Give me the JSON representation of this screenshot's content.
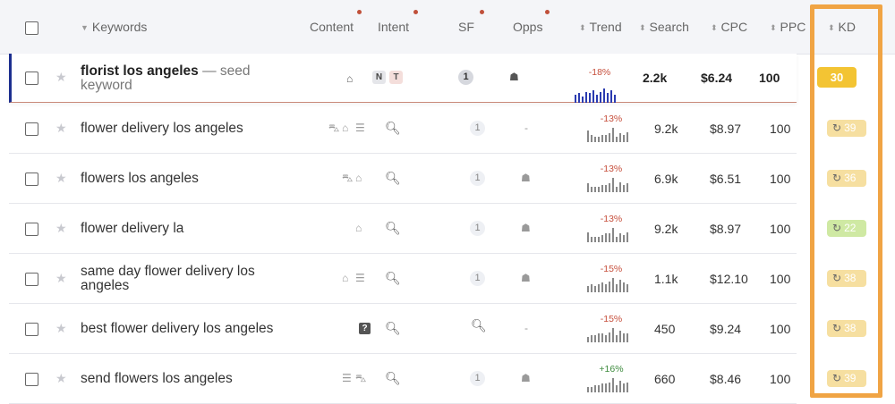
{
  "header": {
    "keywords": "Keywords",
    "content": "Content",
    "intent": "Intent",
    "sf": "SF",
    "opps": "Opps",
    "trend": "Trend",
    "search": "Search",
    "cpc": "CPC",
    "ppc": "PPC",
    "kd": "KD"
  },
  "seed": {
    "keyword": "florist los angeles",
    "suffix": "— seed",
    "suffix2": "keyword",
    "intent_n": "N",
    "intent_t": "T",
    "sf": "1",
    "trend_pct": "-18%",
    "trend": [
      5,
      6,
      4,
      7,
      6,
      8,
      5,
      7,
      9,
      6,
      8,
      5
    ],
    "search": "2.2k",
    "cpc": "$6.24",
    "ppc": "100",
    "kd": "30"
  },
  "rows": [
    {
      "keyword": "flower delivery los angeles",
      "line2": "",
      "content": "car-icon home-icon list-icon",
      "sf": "1",
      "opps": "-",
      "trend_pct": "-13%",
      "trend_dir": "neg",
      "trend": [
        8,
        5,
        4,
        4,
        5,
        5,
        6,
        10,
        4,
        6,
        5,
        7
      ],
      "search": "9.2k",
      "cpc": "$8.97",
      "ppc": "100",
      "kd": "39",
      "kd_color": "yellow"
    },
    {
      "keyword": "flowers los angeles",
      "line2": "",
      "content": "car-icon home-icon",
      "sf": "1",
      "opps": "ghost",
      "trend_pct": "-13%",
      "trend_dir": "neg",
      "trend": [
        6,
        4,
        4,
        4,
        5,
        5,
        6,
        10,
        4,
        7,
        5,
        6
      ],
      "search": "6.9k",
      "cpc": "$6.51",
      "ppc": "100",
      "kd": "36",
      "kd_color": "yellow"
    },
    {
      "keyword": "flower delivery la",
      "line2": "",
      "content": "home-icon",
      "sf": "1",
      "opps": "ghost",
      "trend_pct": "-13%",
      "trend_dir": "neg",
      "trend": [
        7,
        4,
        4,
        4,
        5,
        6,
        6,
        10,
        4,
        6,
        5,
        7
      ],
      "search": "9.2k",
      "cpc": "$8.97",
      "ppc": "100",
      "kd": "22",
      "kd_color": "green"
    },
    {
      "keyword": "same day flower delivery los",
      "line2": "angeles",
      "content": "home-icon list-icon",
      "sf": "1",
      "opps": "ghost",
      "trend_pct": "-15%",
      "trend_dir": "neg",
      "trend": [
        4,
        5,
        4,
        5,
        6,
        5,
        7,
        9,
        5,
        8,
        6,
        5
      ],
      "search": "1.1k",
      "cpc": "$12.10",
      "ppc": "100",
      "kd": "38",
      "kd_color": "yellow"
    },
    {
      "keyword": "best flower delivery los angeles",
      "line2": "",
      "content": "question-icon",
      "sf": "search",
      "opps": "-",
      "trend_pct": "-15%",
      "trend_dir": "neg",
      "trend": [
        4,
        5,
        5,
        6,
        6,
        5,
        7,
        10,
        5,
        8,
        6,
        6
      ],
      "search": "450",
      "cpc": "$9.24",
      "ppc": "100",
      "kd": "38",
      "kd_color": "yellow"
    },
    {
      "keyword": "send flowers los angeles",
      "line2": "",
      "content": "list-icon car-icon",
      "sf": "1",
      "opps": "ghost",
      "trend_pct": "+16%",
      "trend_dir": "pos",
      "trend": [
        4,
        4,
        5,
        5,
        6,
        6,
        7,
        10,
        5,
        8,
        6,
        7
      ],
      "search": "660",
      "cpc": "$8.46",
      "ppc": "100",
      "kd": "39",
      "kd_color": "yellow"
    }
  ],
  "colors": {
    "highlight": "#f0a444",
    "seed_border": "#1c2e8f",
    "kd_seed": "#f3c433",
    "kd_yellow": "#f6dfa0",
    "kd_green": "#cfe9a3"
  }
}
